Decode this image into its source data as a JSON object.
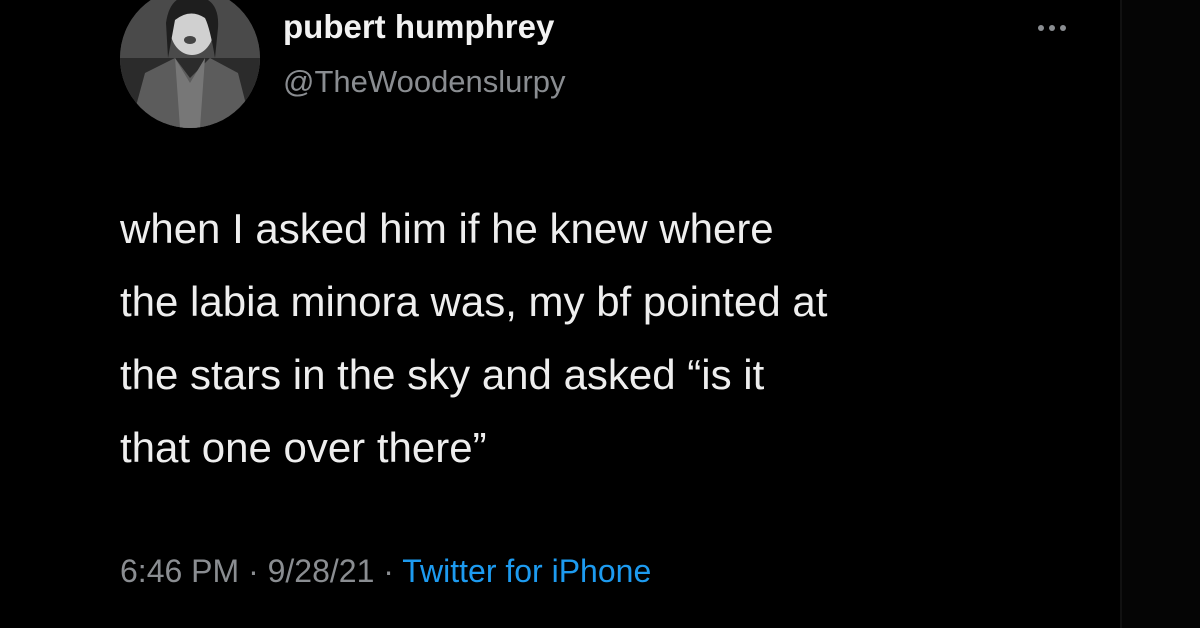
{
  "tweet": {
    "author": {
      "display_name": "pubert humphrey",
      "handle": "@TheWoodenslurpy",
      "avatar_icon": "profile-photo"
    },
    "more_icon": "ellipsis-icon",
    "text_lines": [
      "when I asked him if he knew where",
      "the labia minora was, my bf pointed at",
      "the stars in the sky and asked “is it",
      "that one over there”"
    ],
    "time": "6:46 PM",
    "separator": "·",
    "date": "9/28/21",
    "source": "Twitter for iPhone"
  },
  "colors": {
    "background": "#000000",
    "primary_text": "#eeeeee",
    "secondary_text": "#8a8d91",
    "link": "#1d9bf0"
  }
}
